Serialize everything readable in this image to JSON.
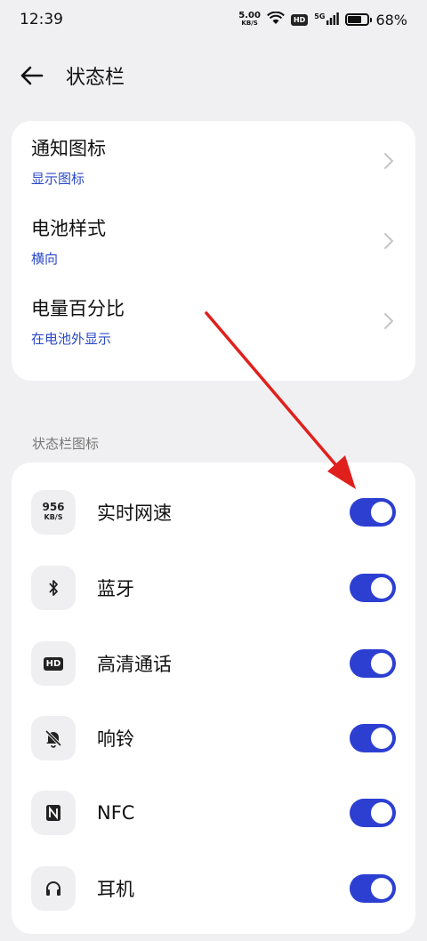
{
  "status_bar": {
    "time": "12:39",
    "net_speed_value": "5.00",
    "net_speed_unit": "KB/S",
    "hd_badge": "HD",
    "network_type": "5G",
    "battery_percent": "68%",
    "battery_level": 0.68
  },
  "header": {
    "title": "状态栏",
    "back_icon": "arrow-left-icon"
  },
  "settings_card": {
    "items": [
      {
        "title": "通知图标",
        "subtitle": "显示图标"
      },
      {
        "title": "电池样式",
        "subtitle": "横向"
      },
      {
        "title": "电量百分比",
        "subtitle": "在电池外显示"
      }
    ]
  },
  "status_icons_section": {
    "label": "状态栏图标",
    "items": [
      {
        "label": "实时网速",
        "icon": "net-speed-icon",
        "icon_text_value": "956",
        "icon_text_unit": "KB/S",
        "enabled": true
      },
      {
        "label": "蓝牙",
        "icon": "bluetooth-icon",
        "enabled": true
      },
      {
        "label": "高清通话",
        "icon": "hd-call-icon",
        "icon_text": "HD",
        "enabled": true
      },
      {
        "label": "响铃",
        "icon": "bell-muted-icon",
        "enabled": true
      },
      {
        "label": "NFC",
        "icon": "nfc-icon",
        "enabled": true
      },
      {
        "label": "耳机",
        "icon": "headphones-icon",
        "enabled": true
      }
    ]
  },
  "colors": {
    "accent": "#2c3fd1",
    "subtitle_blue": "#2c49c7",
    "background": "#f0f0f2",
    "card": "#ffffff",
    "annotation_arrow": "#e0201c"
  }
}
